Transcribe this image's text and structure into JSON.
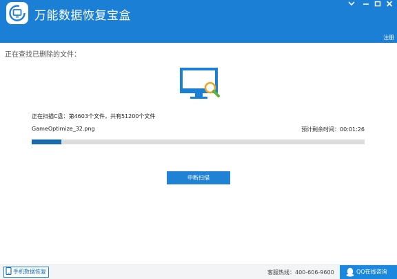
{
  "app": {
    "title": "万能数据恢复宝盒",
    "register_label": "注册"
  },
  "window_controls": {
    "dropdown_icon": "chevron-down-icon",
    "minimize_icon": "minimize-icon",
    "maximize_icon": "maximize-icon",
    "close_icon": "close-icon"
  },
  "scan": {
    "heading": "正在查找已删除的文件：",
    "status": "正在扫描C盘：第4603个文件，共有51200个文件",
    "current_file": "GameOptimize_32.png",
    "remaining_time": "预计剩余时间：00:01:26",
    "progress": 0.09,
    "stop_button": "中断扫描"
  },
  "footer": {
    "mobile_recovery": "手机数据恢复",
    "hotline": "客服热线：400-606-9600",
    "qq_consult": "QQ在线咨询"
  },
  "colors": {
    "titlebar": "#1b7fd6",
    "progress_fill": "#1869ad",
    "progress_track": "#dcdcdc",
    "button": "#1f82d4"
  }
}
